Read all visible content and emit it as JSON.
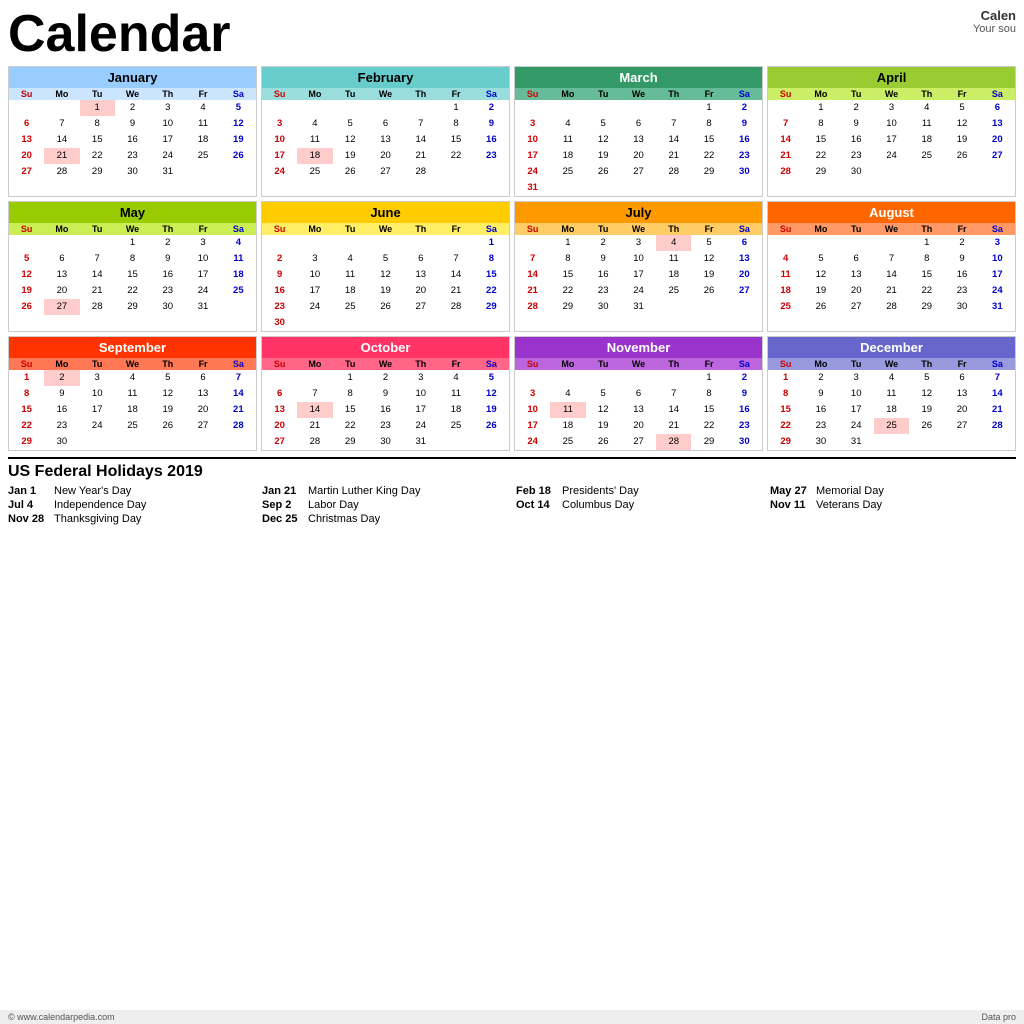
{
  "header": {
    "title": "Calendar",
    "year": "2019",
    "site_name": "Calen",
    "site_tagline": "Your sou"
  },
  "months": [
    {
      "name": "January",
      "theme": "jan",
      "days_header": [
        "Su",
        "Mo",
        "Tu",
        "We",
        "Th",
        "Fr",
        "Sa"
      ],
      "weeks": [
        [
          "",
          "",
          "1",
          "2",
          "3",
          "4",
          "5"
        ],
        [
          "6",
          "7",
          "8",
          "9",
          "10",
          "11",
          "12"
        ],
        [
          "13",
          "14",
          "15",
          "16",
          "17",
          "18",
          "19"
        ],
        [
          "20",
          "21",
          "22",
          "23",
          "24",
          "25",
          "26"
        ],
        [
          "27",
          "28",
          "29",
          "30",
          "31",
          "",
          ""
        ]
      ],
      "holidays": [
        1,
        21
      ]
    },
    {
      "name": "February",
      "theme": "feb",
      "days_header": [
        "Su",
        "Mo",
        "Tu",
        "We",
        "Th",
        "Fr",
        "Sa"
      ],
      "weeks": [
        [
          "",
          "",
          "",
          "",
          "",
          "1",
          "2"
        ],
        [
          "3",
          "4",
          "5",
          "6",
          "7",
          "8",
          "9"
        ],
        [
          "10",
          "11",
          "12",
          "13",
          "14",
          "15",
          "16"
        ],
        [
          "17",
          "18",
          "19",
          "20",
          "21",
          "22",
          "23"
        ],
        [
          "24",
          "25",
          "26",
          "27",
          "28",
          "",
          ""
        ]
      ],
      "holidays": [
        18
      ]
    },
    {
      "name": "March",
      "theme": "mar",
      "days_header": [
        "Su",
        "Mo",
        "Tu",
        "We",
        "Th",
        "Fr",
        "Sa"
      ],
      "weeks": [
        [
          "",
          "",
          "",
          "",
          "",
          "1",
          "2"
        ],
        [
          "3",
          "4",
          "5",
          "6",
          "7",
          "8",
          "9"
        ],
        [
          "10",
          "11",
          "12",
          "13",
          "14",
          "15",
          "16"
        ],
        [
          "17",
          "18",
          "19",
          "20",
          "21",
          "22",
          "23"
        ],
        [
          "24",
          "25",
          "26",
          "27",
          "28",
          "29",
          "30"
        ],
        [
          "31",
          "",
          "",
          "",
          "",
          "",
          ""
        ]
      ],
      "holidays": []
    },
    {
      "name": "April",
      "theme": "apr",
      "days_header": [
        "Su",
        "Mo",
        "Tu",
        "We",
        "Th",
        "Fr",
        "Sa"
      ],
      "weeks": [
        [
          "",
          "1",
          "2",
          "3",
          "4",
          "5",
          "6"
        ],
        [
          "7",
          "8",
          "9",
          "10",
          "11",
          "12",
          "13"
        ],
        [
          "14",
          "15",
          "16",
          "17",
          "18",
          "19",
          "20"
        ],
        [
          "21",
          "22",
          "23",
          "24",
          "25",
          "26",
          "27"
        ],
        [
          "28",
          "29",
          "30",
          "",
          "",
          "",
          ""
        ]
      ],
      "holidays": []
    },
    {
      "name": "May",
      "theme": "may",
      "days_header": [
        "Su",
        "Mo",
        "Tu",
        "We",
        "Th",
        "Fr",
        "Sa"
      ],
      "weeks": [
        [
          "",
          "",
          "",
          "1",
          "2",
          "3",
          "4"
        ],
        [
          "5",
          "6",
          "7",
          "8",
          "9",
          "10",
          "11"
        ],
        [
          "12",
          "13",
          "14",
          "15",
          "16",
          "17",
          "18"
        ],
        [
          "19",
          "20",
          "21",
          "22",
          "23",
          "24",
          "25"
        ],
        [
          "26",
          "27",
          "28",
          "29",
          "30",
          "31",
          ""
        ]
      ],
      "holidays": [
        27
      ]
    },
    {
      "name": "June",
      "theme": "jun",
      "days_header": [
        "Su",
        "Mo",
        "Tu",
        "We",
        "Th",
        "Fr",
        "Sa"
      ],
      "weeks": [
        [
          "",
          "",
          "",
          "",
          "",
          "",
          "1"
        ],
        [
          "2",
          "3",
          "4",
          "5",
          "6",
          "7",
          "8"
        ],
        [
          "9",
          "10",
          "11",
          "12",
          "13",
          "14",
          "15"
        ],
        [
          "16",
          "17",
          "18",
          "19",
          "20",
          "21",
          "22"
        ],
        [
          "23",
          "24",
          "25",
          "26",
          "27",
          "28",
          "29"
        ],
        [
          "30",
          "",
          "",
          "",
          "",
          "",
          ""
        ]
      ],
      "holidays": []
    },
    {
      "name": "July",
      "theme": "jul",
      "days_header": [
        "Su",
        "Mo",
        "Tu",
        "We",
        "Th",
        "Fr",
        "Sa"
      ],
      "weeks": [
        [
          "",
          "1",
          "2",
          "3",
          "4",
          "5",
          "6"
        ],
        [
          "7",
          "8",
          "9",
          "10",
          "11",
          "12",
          "13"
        ],
        [
          "14",
          "15",
          "16",
          "17",
          "18",
          "19",
          "20"
        ],
        [
          "21",
          "22",
          "23",
          "24",
          "25",
          "26",
          "27"
        ],
        [
          "28",
          "29",
          "30",
          "31",
          "",
          "",
          ""
        ]
      ],
      "holidays": [
        4
      ]
    },
    {
      "name": "August",
      "theme": "aug",
      "days_header": [
        "Su",
        "Mo",
        "Tu",
        "We",
        "Th",
        "Fr",
        "Sa"
      ],
      "weeks": [
        [
          "",
          "",
          "",
          "",
          "1",
          "2",
          "3"
        ],
        [
          "4",
          "5",
          "6",
          "7",
          "8",
          "9",
          "10"
        ],
        [
          "11",
          "12",
          "13",
          "14",
          "15",
          "16",
          "17"
        ],
        [
          "18",
          "19",
          "20",
          "21",
          "22",
          "23",
          "24"
        ],
        [
          "25",
          "26",
          "27",
          "28",
          "29",
          "30",
          "31"
        ]
      ],
      "holidays": []
    },
    {
      "name": "September",
      "theme": "sep",
      "days_header": [
        "Su",
        "Mo",
        "Tu",
        "We",
        "Th",
        "Fr",
        "Sa"
      ],
      "weeks": [
        [
          "1",
          "2",
          "3",
          "4",
          "5",
          "6",
          "7"
        ],
        [
          "8",
          "9",
          "10",
          "11",
          "12",
          "13",
          "14"
        ],
        [
          "15",
          "16",
          "17",
          "18",
          "19",
          "20",
          "21"
        ],
        [
          "22",
          "23",
          "24",
          "25",
          "26",
          "27",
          "28"
        ],
        [
          "29",
          "30",
          "",
          "",
          "",
          "",
          ""
        ]
      ],
      "holidays": [
        2
      ]
    },
    {
      "name": "October",
      "theme": "oct",
      "days_header": [
        "Su",
        "Mo",
        "Tu",
        "We",
        "Th",
        "Fr",
        "Sa"
      ],
      "weeks": [
        [
          "",
          "",
          "1",
          "2",
          "3",
          "4",
          "5"
        ],
        [
          "6",
          "7",
          "8",
          "9",
          "10",
          "11",
          "12"
        ],
        [
          "13",
          "14",
          "15",
          "16",
          "17",
          "18",
          "19"
        ],
        [
          "20",
          "21",
          "22",
          "23",
          "24",
          "25",
          "26"
        ],
        [
          "27",
          "28",
          "29",
          "30",
          "31",
          "",
          ""
        ]
      ],
      "holidays": [
        14
      ]
    },
    {
      "name": "November",
      "theme": "nov",
      "days_header": [
        "Su",
        "Mo",
        "Tu",
        "We",
        "Th",
        "Fr",
        "Sa"
      ],
      "weeks": [
        [
          "",
          "",
          "",
          "",
          "",
          "1",
          "2"
        ],
        [
          "3",
          "4",
          "5",
          "6",
          "7",
          "8",
          "9"
        ],
        [
          "10",
          "11",
          "12",
          "13",
          "14",
          "15",
          "16"
        ],
        [
          "17",
          "18",
          "19",
          "20",
          "21",
          "22",
          "23"
        ],
        [
          "24",
          "25",
          "26",
          "27",
          "28",
          "29",
          "30"
        ]
      ],
      "holidays": [
        11,
        28
      ]
    },
    {
      "name": "December",
      "theme": "dec",
      "days_header": [
        "Su",
        "Mo",
        "Tu",
        "We",
        "Th",
        "Fr",
        "Sa"
      ],
      "weeks": [
        [
          "1",
          "2",
          "3",
          "4",
          "5",
          "6",
          "7"
        ],
        [
          "8",
          "9",
          "10",
          "11",
          "12",
          "13",
          "14"
        ],
        [
          "15",
          "16",
          "17",
          "18",
          "19",
          "20",
          "21"
        ],
        [
          "22",
          "23",
          "24",
          "25",
          "26",
          "27",
          "28"
        ],
        [
          "29",
          "30",
          "31",
          "",
          "",
          "",
          ""
        ]
      ],
      "holidays": [
        25
      ]
    }
  ],
  "holidays_section": {
    "title": "US Federal Holidays 2019",
    "items": [
      {
        "date": "Jan 1",
        "name": "New Year's Day"
      },
      {
        "date": "Jan 21",
        "name": "Martin Luther King Day"
      },
      {
        "date": "Feb 18",
        "name": "Presidents' Day"
      },
      {
        "date": "May 27",
        "name": "Memorial Day"
      },
      {
        "date": "Jul 4",
        "name": "Independence Day"
      },
      {
        "date": "Sep 2",
        "name": "Labor Day"
      },
      {
        "date": "Oct 14",
        "name": "Columbus Day"
      },
      {
        "date": "Nov 11",
        "name": "Veterans Day"
      },
      {
        "date": "Nov 28",
        "name": "Thanksgiving Day"
      },
      {
        "date": "Dec 25",
        "name": "Christmas Day"
      }
    ]
  },
  "footer": {
    "url": "© www.calendarpedia.com",
    "note": "Data pro"
  }
}
